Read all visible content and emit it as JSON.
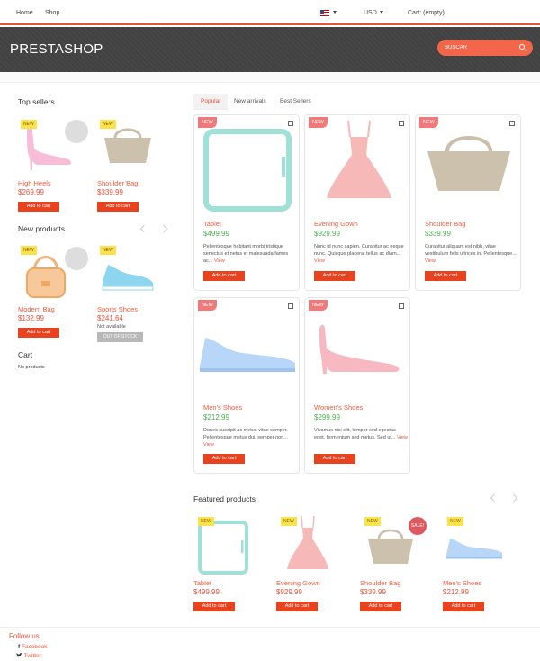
{
  "topbar": {
    "home": "Home",
    "shop": "Shop",
    "currency": "USD",
    "cart": "Cart: (empty)"
  },
  "header": {
    "logo": "PRESTASHOP",
    "search_placeholder": "BUSCAR"
  },
  "sidebar": {
    "top_sellers_title": "Top sellers",
    "top_sellers": [
      {
        "badge": "NEW",
        "name": "High Heels",
        "price": "$269.99",
        "button": "Add to cart"
      },
      {
        "badge": "NEW",
        "name": "Shoulder Bag",
        "price": "$339.99",
        "button": "Add to cart"
      }
    ],
    "new_products_title": "New products",
    "new_products": [
      {
        "badge": "NEW",
        "name": "Modern Bag",
        "price": "$132.99",
        "button": "Add to cart"
      },
      {
        "badge": "NEW",
        "name": "Sports Shoes",
        "price": "$241.64",
        "availability": "Not available",
        "button": "OUT OF STOCK"
      }
    ],
    "cart_title": "Cart",
    "cart_text": "No products"
  },
  "tabs": [
    {
      "label": "Popular",
      "active": true
    },
    {
      "label": "New arrivals",
      "active": false
    },
    {
      "label": "Best Sellers",
      "active": false
    }
  ],
  "grid": [
    {
      "badge": "NEW",
      "name": "Tablet",
      "price": "$499.99",
      "desc": "Pellentesque habitant morbi tristique senectus et netus et malesuada fames ac...",
      "view": "View",
      "button": "Add to cart"
    },
    {
      "badge": "NEW",
      "name": "Evening Gown",
      "price": "$929.99",
      "desc": "Nunc id nunc sapien. Curabitur ac neque nunc. Quisque placerat tellus ac diam...",
      "view": "View",
      "button": "Add to cart"
    },
    {
      "badge": "NEW",
      "name": "Shoulder Bag",
      "price": "$339.99",
      "desc": "Curabitur aliquam est nibh, vitae vestibulum felis ultrices in. Pellentesque...",
      "view": "View",
      "button": "Add to cart"
    },
    {
      "badge": "NEW",
      "name": "Men's Shoes",
      "price": "$212.99",
      "desc": "Donec suscipit ac metus vitae semper. Pellentesque metus dui, semper non...",
      "view": "View",
      "button": "Add to cart"
    },
    {
      "badge": "NEW",
      "name": "Women's Shoes",
      "price": "$299.99",
      "desc": "Vivamus nisi elit, tempor sed egestas eget, fermentum sed metus. Sed ut...",
      "view": "View",
      "button": "Add to cart"
    }
  ],
  "featured": {
    "title": "Featured products",
    "items": [
      {
        "badge": "NEW",
        "name": "Tablet",
        "price": "$499.99",
        "button": "Add to cart"
      },
      {
        "badge": "NEW",
        "name": "Evening Gown",
        "price": "$929.99",
        "button": "Add to cart"
      },
      {
        "badge": "NEW",
        "sale": "SALE!",
        "name": "Shoulder Bag",
        "price": "$339.99",
        "button": "Add to cart"
      },
      {
        "badge": "NEW",
        "name": "Men's Shoes",
        "price": "$212.99",
        "button": "Add to cart"
      }
    ]
  },
  "footer": {
    "follow_title": "Follow us",
    "facebook": "Facebook",
    "twitter": "Twitter",
    "facebook_icon": "f",
    "twitter_icon": "bird-icon"
  },
  "colors": {
    "accent": "#e8533a",
    "green_price": "#4caf50",
    "header_bg": "#454545",
    "new_badge": "#f9e34b"
  }
}
